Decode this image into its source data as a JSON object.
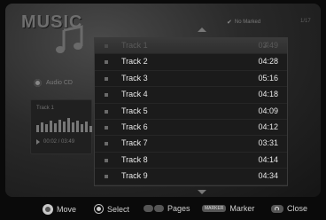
{
  "header": {
    "title": "MUSIC",
    "marked_label": "No Marked",
    "page_count": "1/17"
  },
  "source": {
    "label": "Audio CD"
  },
  "player": {
    "track": "Track 1",
    "time": "00:02 / 03:49"
  },
  "tracks": [
    {
      "name": "Track 1",
      "duration": "03:49"
    },
    {
      "name": "Track 2",
      "duration": "04:28"
    },
    {
      "name": "Track 3",
      "duration": "05:16"
    },
    {
      "name": "Track 4",
      "duration": "04:18"
    },
    {
      "name": "Track 5",
      "duration": "04:09"
    },
    {
      "name": "Track 6",
      "duration": "04:12"
    },
    {
      "name": "Track 7",
      "duration": "03:31"
    },
    {
      "name": "Track 8",
      "duration": "04:14"
    },
    {
      "name": "Track 9",
      "duration": "04:34"
    }
  ],
  "footer": {
    "move": "Move",
    "select": "Select",
    "pages": "Pages",
    "marker_key": "MARKER",
    "marker": "Marker",
    "close": "Close"
  }
}
